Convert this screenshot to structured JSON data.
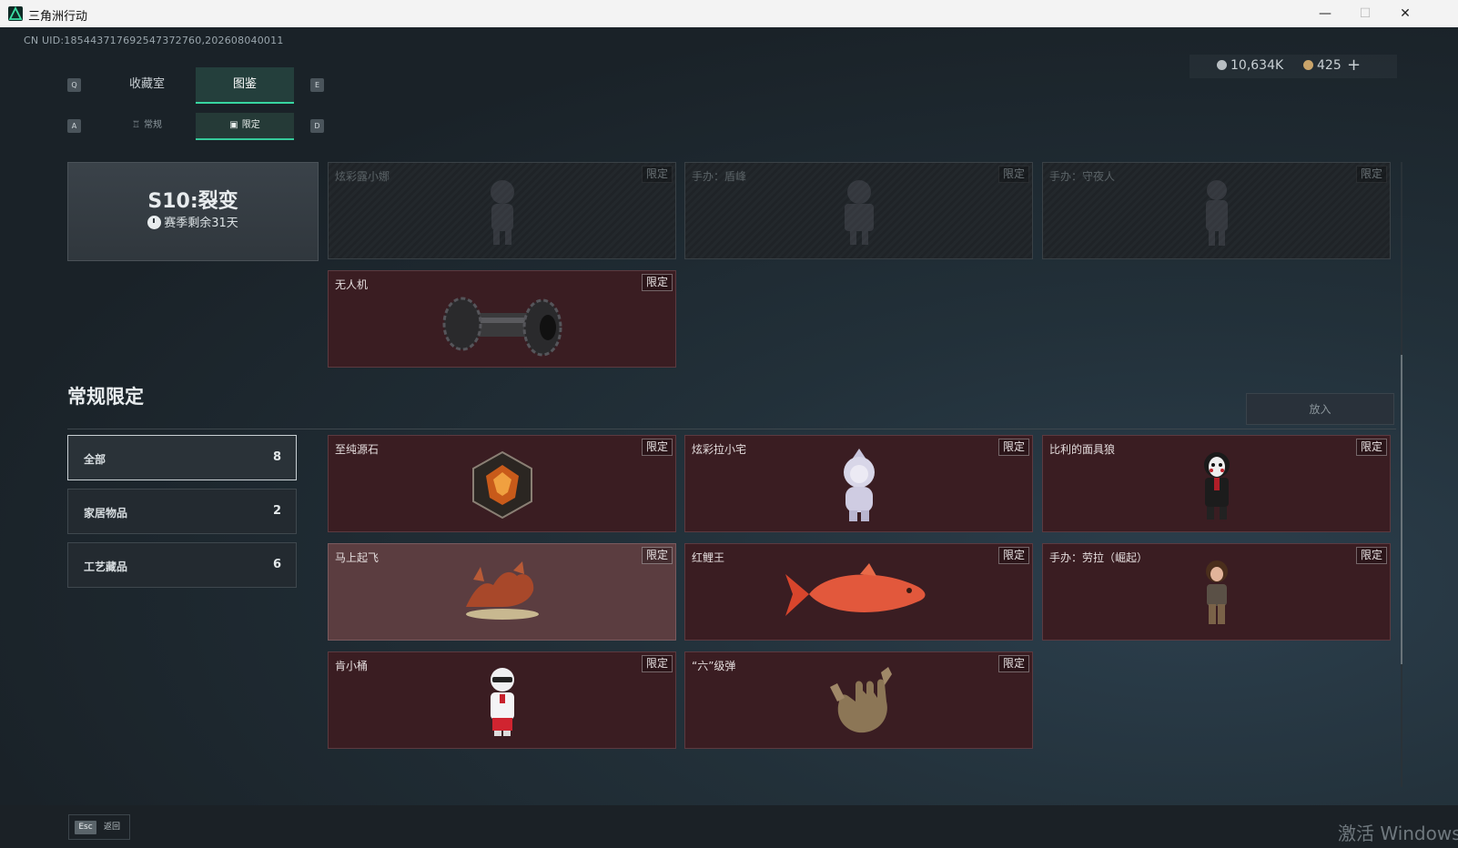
{
  "window": {
    "title": "三角洲行动",
    "minimize": "—",
    "maximize": "☐",
    "close": "✕"
  },
  "header": {
    "uid": "CN UID:185443717692547372760,202608040011",
    "currency": [
      {
        "value": "10,634K",
        "color": "#b8bec2"
      },
      {
        "value": "425",
        "color": "#c9a46a"
      }
    ],
    "add_label": "+"
  },
  "tabs": {
    "prev_key": "Q",
    "next_key": "E",
    "items": [
      {
        "label": "收藏室",
        "active": false
      },
      {
        "label": "图鉴",
        "active": true
      }
    ]
  },
  "subtabs": {
    "prev_key": "A",
    "next_key": "D",
    "items": [
      {
        "label": "常规",
        "icon": "trophy-icon",
        "active": false
      },
      {
        "label": "限定",
        "icon": "image-icon",
        "active": true
      }
    ]
  },
  "season": {
    "title": "S10:裂变",
    "remaining": "赛季剩余31天"
  },
  "season_items": [
    {
      "name": "炫彩露小娜",
      "tag": "限定",
      "locked": true,
      "icon": "figure-icon"
    },
    {
      "name": "手办：盾峰",
      "tag": "限定",
      "locked": true,
      "icon": "figure-icon"
    },
    {
      "name": "手办：守夜人",
      "tag": "限定",
      "locked": true,
      "icon": "figure-icon"
    },
    {
      "name": "无人机",
      "tag": "限定",
      "locked": false,
      "icon": "drone-part-icon"
    }
  ],
  "section": {
    "title": "常规限定",
    "put_in_button": "放入"
  },
  "categories": [
    {
      "label": "全部",
      "count": "8",
      "active": true
    },
    {
      "label": "家居物品",
      "count": "2",
      "active": false
    },
    {
      "label": "工艺藏品",
      "count": "6",
      "active": false
    }
  ],
  "regular_items": [
    {
      "name": "至纯源石",
      "tag": "限定",
      "icon": "gem-icon"
    },
    {
      "name": "炫彩拉小宅",
      "tag": "限定",
      "icon": "astronaut-figure-icon"
    },
    {
      "name": "比利的面具狼",
      "tag": "限定",
      "icon": "puppet-figure-icon"
    },
    {
      "name": "马上起飞",
      "tag": "限定",
      "icon": "horse-sculpture-icon"
    },
    {
      "name": "红鲤王",
      "tag": "限定",
      "icon": "carp-icon"
    },
    {
      "name": "手办：劳拉（崛起）",
      "tag": "限定",
      "icon": "explorer-figure-icon"
    },
    {
      "name": "肯小桶",
      "tag": "限定",
      "icon": "colonel-figure-icon"
    },
    {
      "name": "“六”级弹",
      "tag": "限定",
      "icon": "hand-sculpture-icon"
    }
  ],
  "footer": {
    "esc_key": "Esc",
    "back_label": "返回",
    "watermark": "激活 Windows"
  },
  "colors": {
    "accent": "#37d6a1",
    "card_bg": "#3a1d22",
    "card_highlight": "#5b3d40"
  }
}
